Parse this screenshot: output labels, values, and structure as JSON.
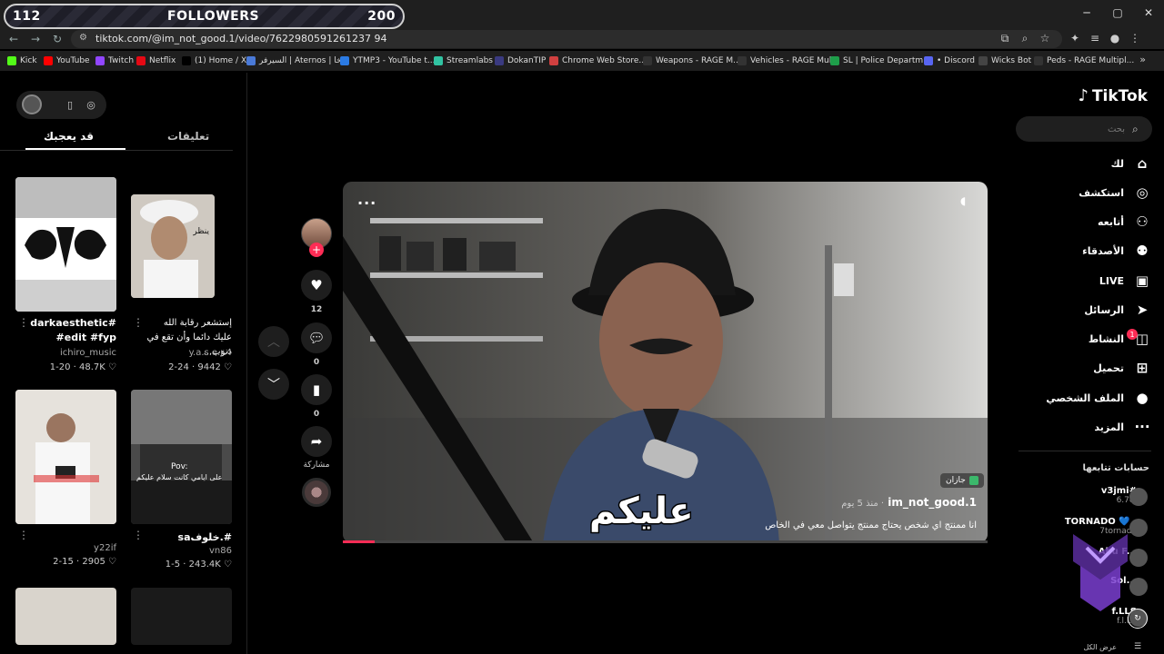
{
  "browser": {
    "overlay": {
      "left_count": "112",
      "label": "FOLLOWERS",
      "right_count": "200"
    },
    "url": "tiktok.com/@im_not_good.1/video/7622980591261237 94",
    "url_full": "tiktok.com/@im_not_good.1/video/7622980591261237 94",
    "bookmarks": [
      {
        "label": "Kick",
        "color": "#53fc18"
      },
      {
        "label": "YouTube",
        "color": "#ff0000"
      },
      {
        "label": "Twitch",
        "color": "#9146ff"
      },
      {
        "label": "Netflix",
        "color": "#e50914"
      },
      {
        "label": "(1) Home / X",
        "color": "#000000"
      },
      {
        "label": "السيرفر | Aternos | خا...",
        "color": "#4a7ad8"
      },
      {
        "label": "YTMP3 - YouTube t...",
        "color": "#2b7be4"
      },
      {
        "label": "Streamlabs",
        "color": "#31c3a2"
      },
      {
        "label": "DokanTIP",
        "color": "#3a3a80"
      },
      {
        "label": "Chrome Web Store...",
        "color": "#d04040"
      },
      {
        "label": "Weapons - RAGE M...",
        "color": "#333333"
      },
      {
        "label": "Vehicles - RAGE Mul...",
        "color": "#333333"
      },
      {
        "label": "SL | Police Departm...",
        "color": "#1e9e4a"
      },
      {
        "label": "• Discord",
        "color": "#5865f2"
      },
      {
        "label": "Wicks Bot",
        "color": "#444444"
      },
      {
        "label": "Peds - RAGE Multipl...",
        "color": "#333333"
      }
    ]
  },
  "left_panel": {
    "tabs": {
      "comments": "تعليقات",
      "you_may_like": "قد يعجبك"
    },
    "videos": [
      {
        "title": "darkaesthetic# #edit #fyp",
        "author": "ichiro_music",
        "stats": "1-20 · 48.7K ♡"
      },
      {
        "title": "إستشعر رقابة الله عليك دائما وأن تقع في ذنوب...",
        "author": "y.a.s.e.r.4",
        "stats": "2-24 · 9442 ♡"
      },
      {
        "title": "",
        "author": "y22if",
        "stats": "2-15 · 2905 ♡"
      },
      {
        "title": "#.خلوفsa",
        "author": "vn86",
        "stats": "1-5 · 243.4K ♡"
      }
    ],
    "thumb_texts": {
      "t2": "ينظر",
      "t4a": "Pov:",
      "t4b": "على ايامي كانت سلام عليكم"
    }
  },
  "feed": {
    "like_count": "12",
    "comment_count": "0",
    "bookmark_count": "0",
    "share_label": "مشاركة",
    "location": "جازان",
    "username": "im_not_good.1",
    "time_ago": "منذ 5 يوم ·",
    "description": "انا ممنتج اي شخص يحتاج ممنتج يتواصل معي في الخاص",
    "caption": "عليكم",
    "progress": 0.05
  },
  "sidebar": {
    "logo": "TikTok",
    "search_placeholder": "بحث",
    "nav": [
      {
        "label": "لك",
        "icon": "home-icon"
      },
      {
        "label": "استكشف",
        "icon": "compass-icon"
      },
      {
        "label": "أتابعه",
        "icon": "user-follow-icon"
      },
      {
        "label": "الأصدقاء",
        "icon": "friends-icon"
      },
      {
        "label": "LIVE",
        "icon": "live-icon"
      },
      {
        "label": "الرسائل",
        "icon": "send-icon"
      },
      {
        "label": "النشاط",
        "icon": "activity-icon"
      },
      {
        "label": "تحميل",
        "icon": "upload-icon"
      },
      {
        "label": "الملف الشخصي",
        "icon": "profile-icon"
      },
      {
        "label": "المزيد",
        "icon": "more-icon"
      }
    ],
    "activity_badge": "1",
    "following_title": "حسابات تتابعها",
    "following": [
      {
        "name": "v3jmi#",
        "handle": "6.7cf"
      },
      {
        "name": "TORNADO 💙 .",
        "handle": "7tornado"
      },
      {
        "name": "Abu F...",
        "handle": ""
      },
      {
        "name": "Sol...",
        "handle": ""
      },
      {
        "name": "f.LLS",
        "handle": "f.l.l.5"
      }
    ],
    "see_all": "عرض الكل"
  }
}
